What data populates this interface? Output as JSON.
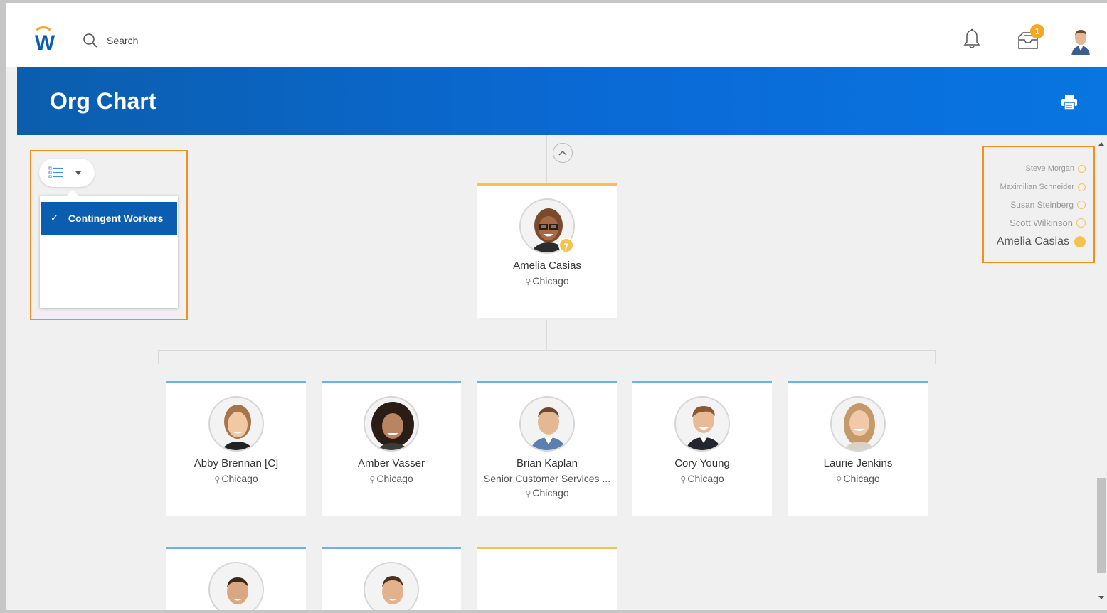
{
  "topbar": {
    "search_placeholder": "Search",
    "inbox_count": "1",
    "logo_letter": "W",
    "icons": {
      "search": "search-icon",
      "bell": "bell-icon",
      "inbox": "inbox-icon",
      "avatar": "user-avatar"
    }
  },
  "header": {
    "title": "Org Chart",
    "print_icon": "print-icon"
  },
  "filter": {
    "icon": "list-view-icon",
    "items": [
      {
        "label": "Contingent Workers",
        "selected": true
      }
    ]
  },
  "breadcrumb": [
    {
      "label": "Steve Morgan"
    },
    {
      "label": "Maximilian Schneider"
    },
    {
      "label": "Susan Steinberg"
    },
    {
      "label": "Scott Wilkinson"
    },
    {
      "label": "Amelia Casias",
      "current": true
    }
  ],
  "manager": {
    "name": "Amelia Casias",
    "location": "Chicago",
    "reports_count": "7"
  },
  "reports": [
    {
      "name": "Abby Brennan [C]",
      "location": "Chicago"
    },
    {
      "name": "Amber Vasser",
      "location": "Chicago"
    },
    {
      "name": "Brian Kaplan",
      "title": "Senior Customer Services ...",
      "location": "Chicago"
    },
    {
      "name": "Cory Young",
      "location": "Chicago"
    },
    {
      "name": "Laurie Jenkins",
      "location": "Chicago"
    }
  ],
  "colors": {
    "brand_blue": "#0b5eaf",
    "accent_orange": "#f5a623",
    "manager_border": "#f5c250",
    "report_border": "#6cb2e5",
    "highlight": "#f0901e"
  }
}
